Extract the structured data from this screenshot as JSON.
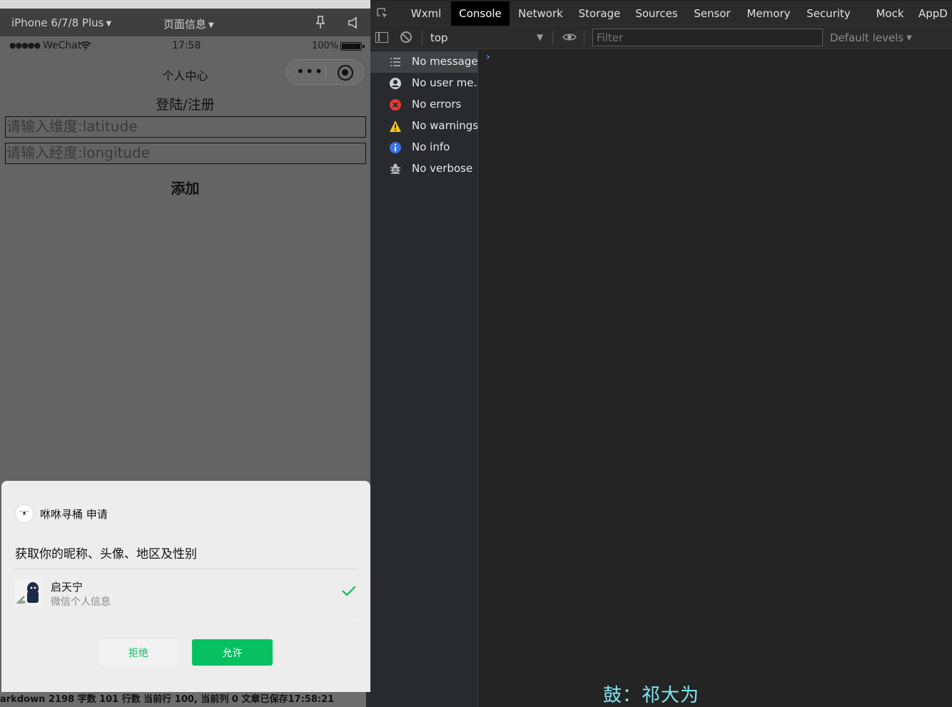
{
  "simulator": {
    "device": "iPhone 6/7/8 Plus",
    "page_info": "页面信息",
    "status": {
      "signal": "●●●●●",
      "carrier": "WeChat",
      "time": "17:58",
      "battery": "100%"
    },
    "nav_title": "个人中心",
    "page_heading": "登陆/注册",
    "latitude_placeholder": "请输入维度:latitude",
    "longitude_placeholder": "请输入经度:longitude",
    "add_label": "添加",
    "auth_sheet": {
      "app_name": "咻咻寻桶 申请",
      "app_avatar_text": "ᵔᴥᵔ",
      "request": "获取你的昵称、头像、地区及性别",
      "user_name": "启天宁",
      "user_sub": "微信个人信息",
      "reject_label": "拒绝",
      "allow_label": "允许"
    },
    "bottom_status": "arkdown  2198 字数  101 行数  当前行 100, 当前列 0  文章已保存17:58:21"
  },
  "devtools": {
    "tabs": [
      "Wxml",
      "Console",
      "Network",
      "Storage",
      "Sources",
      "Sensor",
      "Memory",
      "Security",
      "Mock",
      "AppD"
    ],
    "active_tab": "Console",
    "context": "top",
    "filter_placeholder": "Filter",
    "levels_label": "Default levels",
    "sidebar": [
      {
        "label": "No messages",
        "icon": "list-icon"
      },
      {
        "label": "No user me...",
        "icon": "user-icon"
      },
      {
        "label": "No errors",
        "icon": "error-icon"
      },
      {
        "label": "No warnings",
        "icon": "warning-icon"
      },
      {
        "label": "No info",
        "icon": "info-icon"
      },
      {
        "label": "No verbose",
        "icon": "bug-icon"
      }
    ],
    "prompt_symbol": "›"
  },
  "caption": "鼓：祁大为",
  "colors": {
    "accent_green": "#07c160",
    "active_tab_bg": "#000000",
    "subtitle": "#7fe6f2",
    "error": "#e53935",
    "warning": "#f5c518",
    "info": "#3b74e0"
  }
}
